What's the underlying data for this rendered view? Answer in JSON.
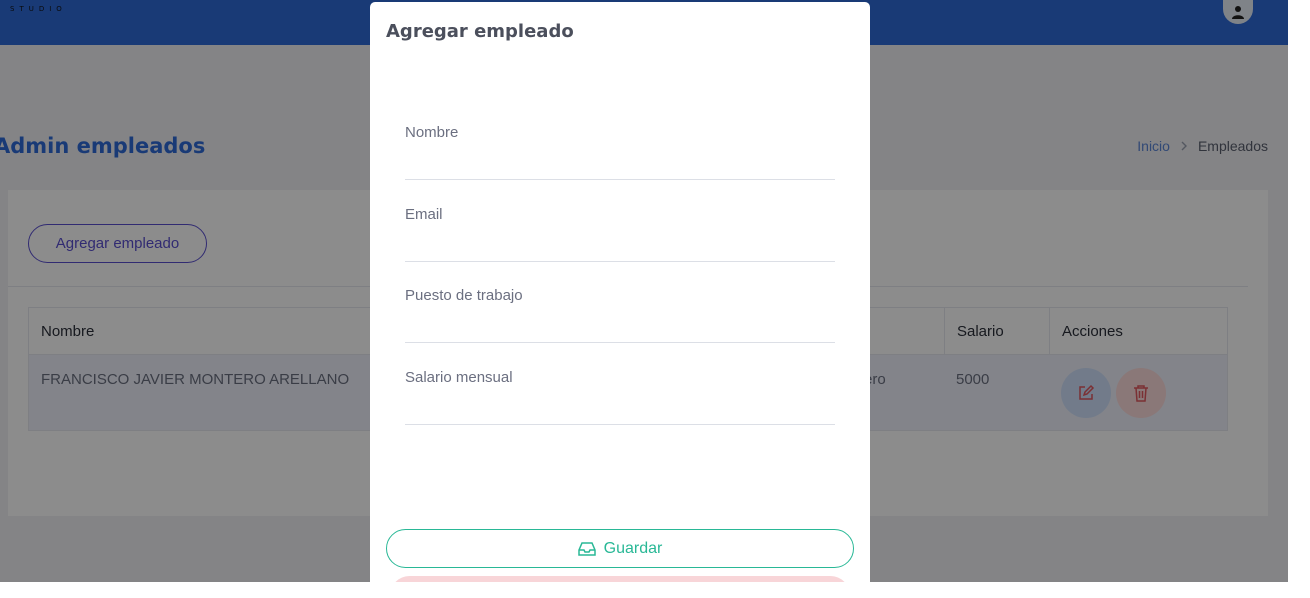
{
  "header": {
    "logo": "STUDIO",
    "avatar_icon": "user-avatar-icon",
    "bg_color": "#2f6bd8"
  },
  "page": {
    "title": "Admin empleados"
  },
  "breadcrumb": {
    "home": "Inicio",
    "current": "Empleados"
  },
  "toolbar": {
    "add_label": "Agregar empleado"
  },
  "table": {
    "columns": {
      "nombre": "Nombre",
      "salario": "Salario",
      "acciones": "Acciones"
    },
    "rows": [
      {
        "nombre": "FRANCISCO JAVIER MONTERO ARELLANO",
        "puesto_partial": "ero",
        "salario": "5000"
      }
    ]
  },
  "modal": {
    "title": "Agregar empleado",
    "fields": [
      {
        "label": "Nombre",
        "value": "",
        "placeholder": ""
      },
      {
        "label": "Email",
        "value": "",
        "placeholder": ""
      },
      {
        "label": "Puesto de trabajo",
        "value": "",
        "placeholder": ""
      },
      {
        "label": "Salario mensual",
        "value": "",
        "placeholder": ""
      }
    ],
    "save_label": "Guardar"
  },
  "colors": {
    "accent": "#2f6bd8",
    "save": "#29b896",
    "add": "#5a4fcf",
    "danger": "#e0585f"
  }
}
